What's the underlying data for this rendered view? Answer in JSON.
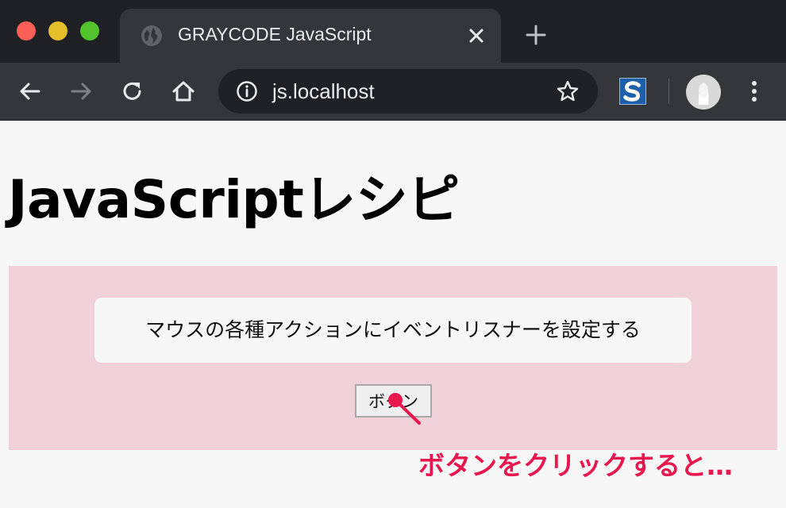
{
  "browser": {
    "tab": {
      "title": "GRAYCODE JavaScript"
    },
    "omnibox": {
      "url": "js.localhost"
    }
  },
  "page": {
    "title": "JavaScriptレシピ",
    "demo": {
      "message": "マウスの各種アクションにイベントリスナーを設定する",
      "button_label": "ボタン"
    },
    "annotation": {
      "text": "ボタンをクリックすると…",
      "color": "#e8174e"
    }
  },
  "colors": {
    "chrome_dark": "#202124",
    "chrome_toolbar": "#35363a",
    "demo_background": "#f0d1da",
    "traffic_red": "#fd5e57",
    "traffic_yellow": "#e4bf2b",
    "traffic_green": "#53c32d"
  },
  "icons": [
    "globe-icon",
    "close-icon",
    "plus-icon",
    "back-icon",
    "forward-icon",
    "reload-icon",
    "home-icon",
    "info-icon",
    "star-icon",
    "extension-s-icon",
    "avatar",
    "more-vert-icon"
  ]
}
